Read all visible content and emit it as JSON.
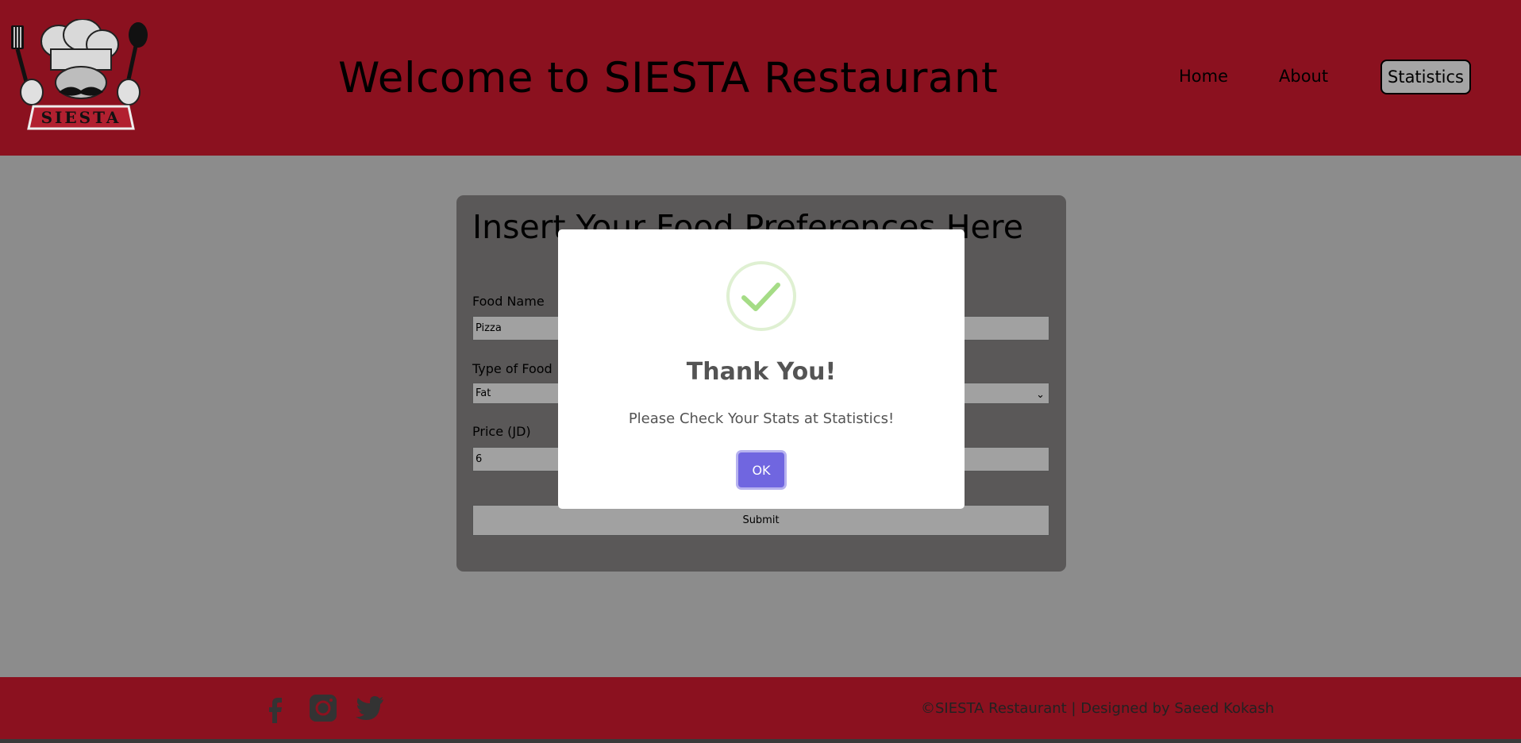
{
  "header": {
    "logo_text": "SIESTA",
    "title": "Welcome to SIESTA Restaurant",
    "nav": {
      "home": "Home",
      "about": "About",
      "statistics": "Statistics"
    }
  },
  "form": {
    "title": "Insert Your Food Preferences Here",
    "food_name_label": "Food Name",
    "food_name_value": "Pizza",
    "type_label": "Type of Food",
    "type_value": "Fat",
    "price_label": "Price (JD)",
    "price_value": "6",
    "submit_label": "Submit"
  },
  "modal": {
    "icon": "success-check-icon",
    "title": "Thank You!",
    "message": "Please Check Your Stats at Statistics!",
    "ok_label": "OK",
    "ok_color": "#7066e0"
  },
  "footer": {
    "social_icons": [
      "facebook-icon",
      "instagram-icon",
      "twitter-icon"
    ],
    "copyright": "©SIESTA Restaurant | Designed by Saeed Kokash"
  },
  "colors": {
    "brand_red": "#8b111f",
    "background": "#8c8c8c",
    "card": "#5a5858"
  }
}
